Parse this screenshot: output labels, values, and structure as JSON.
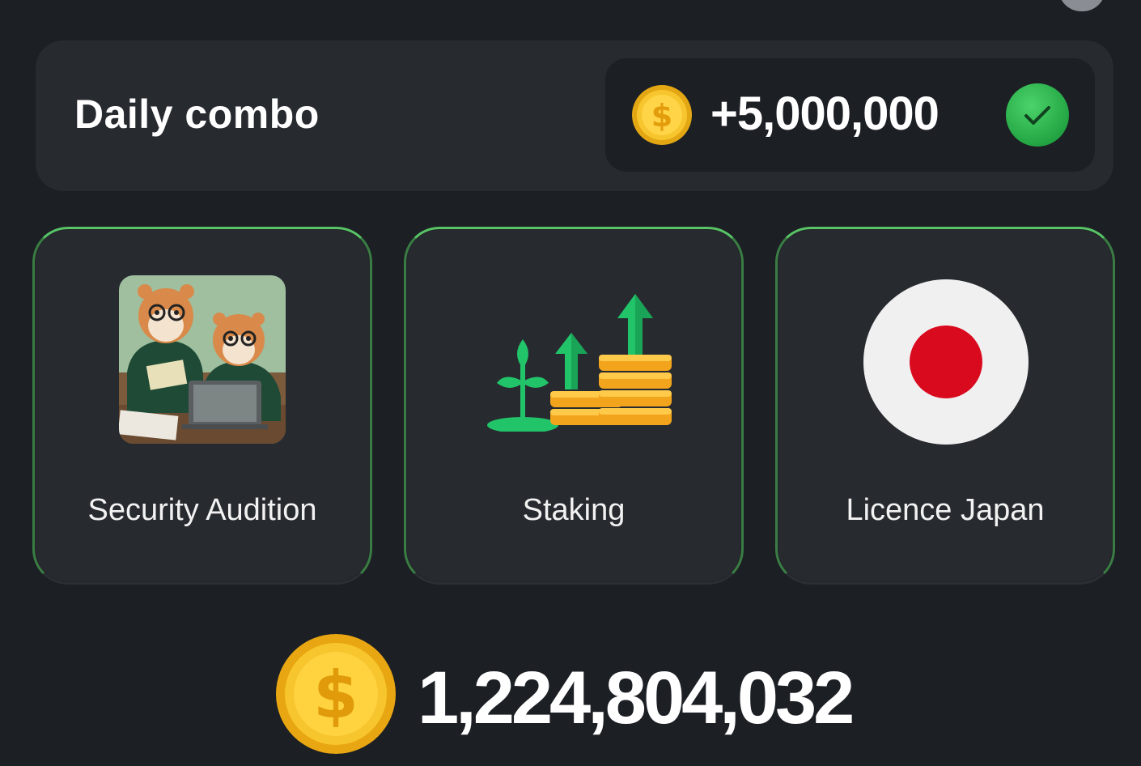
{
  "daily_combo": {
    "title": "Daily combo",
    "reward": "+5,000,000",
    "completed": true
  },
  "cards": [
    {
      "label": "Security Audition",
      "image": "hamsters-auditing-illustration"
    },
    {
      "label": "Staking",
      "image": "staking-growth-icon"
    },
    {
      "label": "Licence Japan",
      "image": "japan-flag-icon"
    }
  ],
  "balance": {
    "amount": "1,224,804,032"
  },
  "colors": {
    "background": "#1c1f24",
    "panel": "#272a2f",
    "card_border": "#58c465",
    "coin": "#f5c431",
    "success": "#23a543",
    "japan_red": "#d90a1e"
  }
}
